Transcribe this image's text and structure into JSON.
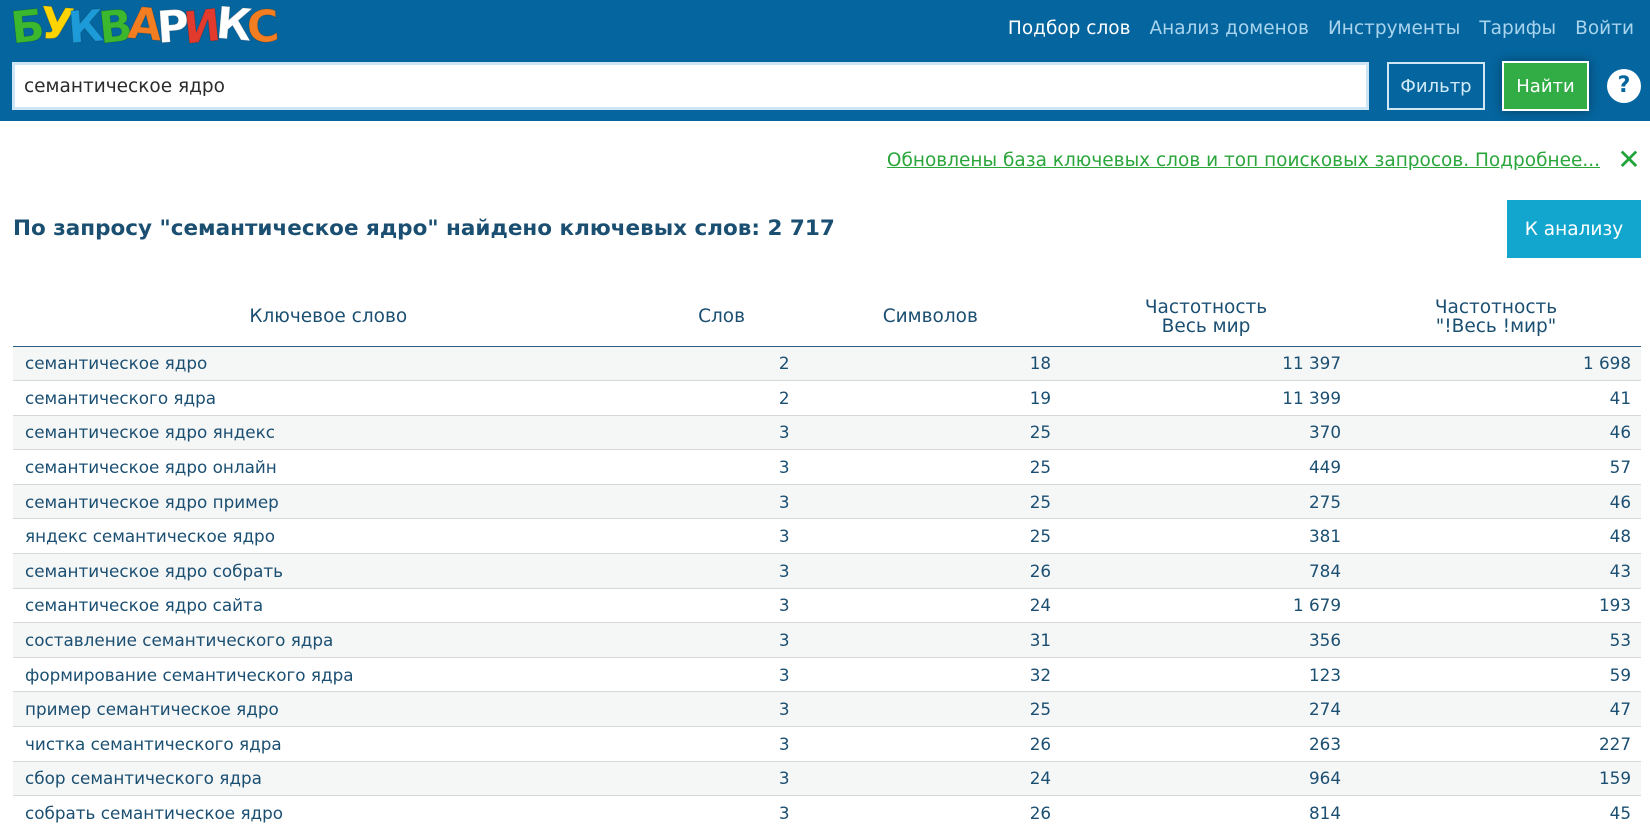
{
  "logo": {
    "letters": [
      {
        "ch": "Б",
        "color": "#3cb82f"
      },
      {
        "ch": "У",
        "color": "#ffd400"
      },
      {
        "ch": "К",
        "color": "#1d9bd8"
      },
      {
        "ch": "В",
        "color": "#3cb82f"
      },
      {
        "ch": "А",
        "color": "#f37d21"
      },
      {
        "ch": "Р",
        "color": "#ffffff"
      },
      {
        "ch": "И",
        "color": "#e23b2e"
      },
      {
        "ch": "К",
        "color": "#ffffff"
      },
      {
        "ch": "С",
        "color": "#f37d21"
      }
    ]
  },
  "nav": {
    "items": [
      {
        "label": "Подбор слов",
        "active": true
      },
      {
        "label": "Анализ доменов",
        "active": false
      },
      {
        "label": "Инструменты",
        "active": false
      },
      {
        "label": "Тарифы",
        "active": false
      },
      {
        "label": "Войти",
        "active": false
      }
    ]
  },
  "search": {
    "value": "семантическое ядро",
    "filter_label": "Фильтр",
    "find_label": "Найти",
    "help_label": "?"
  },
  "notice": {
    "text": "Обновлены база ключевых слов и топ поисковых запросов. Подробнее...",
    "close_icon": "✕"
  },
  "results": {
    "title": "По запросу \"семантическое ядро\" найдено ключевых слов: 2 717",
    "analyze_label": "К анализу"
  },
  "table": {
    "headers": {
      "keyword": "Ключевое слово",
      "words": "Слов",
      "chars": "Символов",
      "freq_line1": "Частотность",
      "freq_line2": "Весь мир",
      "exact_line1": "Частотность",
      "exact_line2": "\"!Весь !мир\""
    },
    "rows": [
      {
        "keyword": "семантическое ядро",
        "words": "2",
        "chars": "18",
        "freq": "11 397",
        "exact": "1 698"
      },
      {
        "keyword": "семантического ядра",
        "words": "2",
        "chars": "19",
        "freq": "11 399",
        "exact": "41"
      },
      {
        "keyword": "семантическое ядро яндекс",
        "words": "3",
        "chars": "25",
        "freq": "370",
        "exact": "46"
      },
      {
        "keyword": "семантическое ядро онлайн",
        "words": "3",
        "chars": "25",
        "freq": "449",
        "exact": "57"
      },
      {
        "keyword": "семантическое ядро пример",
        "words": "3",
        "chars": "25",
        "freq": "275",
        "exact": "46"
      },
      {
        "keyword": "яндекс семантическое ядро",
        "words": "3",
        "chars": "25",
        "freq": "381",
        "exact": "48"
      },
      {
        "keyword": "семантическое ядро собрать",
        "words": "3",
        "chars": "26",
        "freq": "784",
        "exact": "43"
      },
      {
        "keyword": "семантическое ядро сайта",
        "words": "3",
        "chars": "24",
        "freq": "1 679",
        "exact": "193"
      },
      {
        "keyword": "составление семантического ядра",
        "words": "3",
        "chars": "31",
        "freq": "356",
        "exact": "53"
      },
      {
        "keyword": "формирование семантического ядра",
        "words": "3",
        "chars": "32",
        "freq": "123",
        "exact": "59"
      },
      {
        "keyword": "пример семантическое ядро",
        "words": "3",
        "chars": "25",
        "freq": "274",
        "exact": "47"
      },
      {
        "keyword": "чистка семантического ядра",
        "words": "3",
        "chars": "26",
        "freq": "263",
        "exact": "227"
      },
      {
        "keyword": "сбор семантического ядра",
        "words": "3",
        "chars": "24",
        "freq": "964",
        "exact": "159"
      },
      {
        "keyword": "собрать семантическое ядро",
        "words": "3",
        "chars": "26",
        "freq": "814",
        "exact": "45"
      }
    ]
  }
}
